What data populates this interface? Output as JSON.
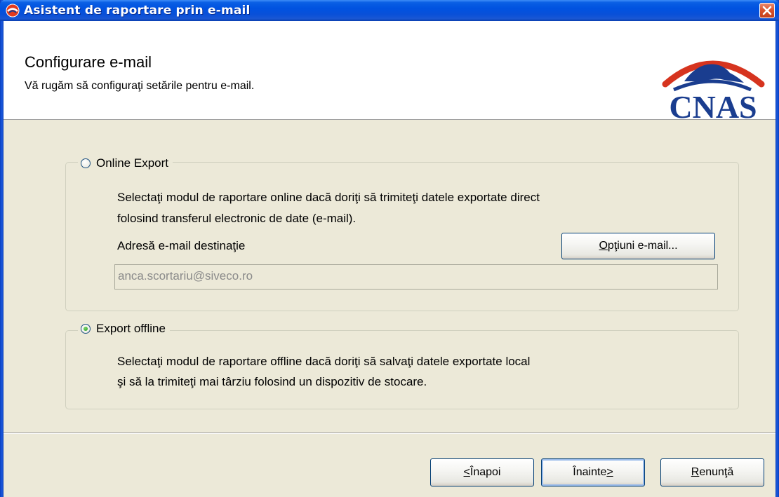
{
  "window": {
    "title": "Asistent de raportare prin e-mail"
  },
  "header": {
    "title": "Configurare e-mail",
    "subtitle": "Vă rugăm să configuraţi setările pentru e-mail.",
    "logo_text": "CNAS"
  },
  "online": {
    "label": "Online Export",
    "selected": false,
    "desc_line1": "Selectaţi modul de raportare online dacă doriţi să trimiteţi datele exportate direct",
    "desc_line2": "folosind transferul electronic de date (e-mail).",
    "address_label": "Adresă e-mail destinaţie",
    "options_button": {
      "u": "O",
      "rest": "pţiuni e-mail..."
    },
    "email_value": "anca.scortariu@siveco.ro"
  },
  "offline": {
    "label": "Export offline",
    "selected": true,
    "desc_line1": "Selectaţi modul de raportare offline dacă doriţi să salvaţi datele exportate local",
    "desc_line2": "şi să la trimiteţi mai târziu folosind un dispozitiv de stocare."
  },
  "buttons": {
    "back": {
      "u": "<",
      "rest": " Înapoi"
    },
    "next": {
      "pre": "Înainte ",
      "u": ">"
    },
    "cancel": {
      "u": "R",
      "rest": "enunţă"
    }
  },
  "colors": {
    "title_bar": "#0052e0",
    "body_bg": "#ece9d8",
    "logo_red": "#d6341f",
    "logo_blue": "#1a3d8f"
  }
}
